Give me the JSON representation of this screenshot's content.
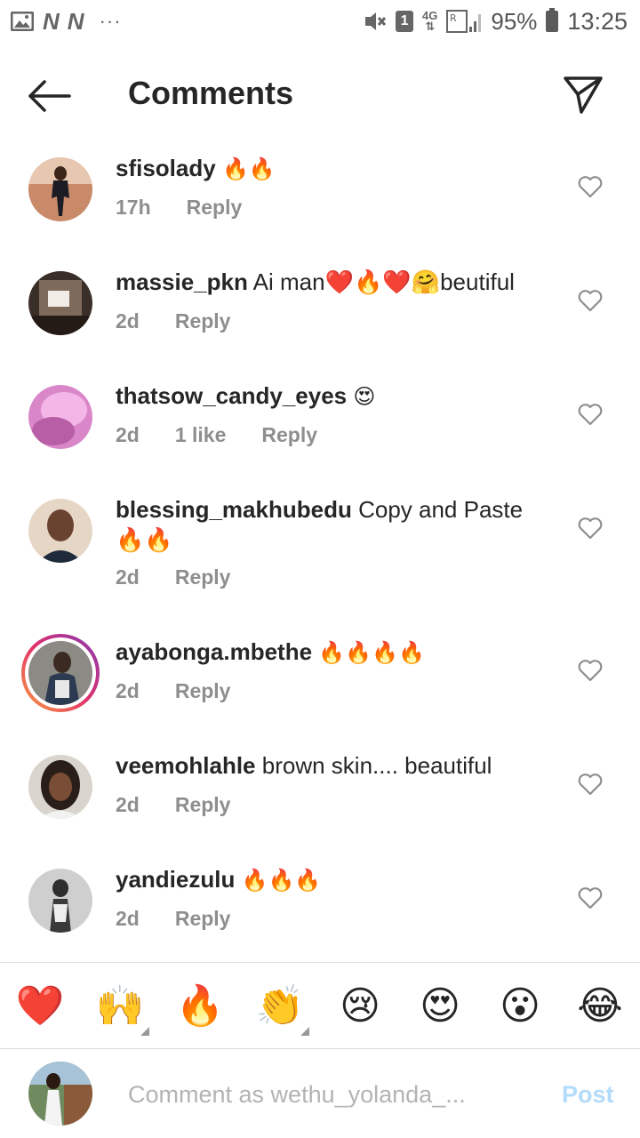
{
  "status_bar": {
    "left_letters": [
      "N",
      "N"
    ],
    "dots": "···",
    "sim_badge": "1",
    "network": "4G",
    "roaming": "R",
    "battery": "95%",
    "time": "13:25"
  },
  "header": {
    "title": "Comments",
    "back_icon": "arrow-left-icon",
    "send_icon": "paper-plane-icon"
  },
  "comments": [
    {
      "username": "sfisolady",
      "text": "🔥🔥",
      "time": "17h",
      "likes": "",
      "reply": "Reply"
    },
    {
      "username": "massie_pkn",
      "text": "Ai man❤️🔥❤️🤗beutiful",
      "time": "2d",
      "likes": "",
      "reply": "Reply"
    },
    {
      "username": "thatsow_candy_eyes",
      "text": "😍",
      "time": "2d",
      "likes": "1 like",
      "reply": "Reply"
    },
    {
      "username": "blessing_makhubedu",
      "text": "Copy and Paste 🔥🔥",
      "time": "2d",
      "likes": "",
      "reply": "Reply"
    },
    {
      "username": "ayabonga.mbethe",
      "text": "🔥🔥🔥🔥",
      "time": "2d",
      "likes": "",
      "reply": "Reply",
      "story_ring": true
    },
    {
      "username": "veemohlahle",
      "text": "brown skin.... beautiful",
      "time": "2d",
      "likes": "",
      "reply": "Reply"
    },
    {
      "username": "yandiezulu",
      "text": "🔥🔥🔥",
      "time": "2d",
      "likes": "",
      "reply": "Reply"
    }
  ],
  "quick_emojis": [
    "❤️",
    "🙌",
    "🔥",
    "👏",
    "😢",
    "😍",
    "😮",
    "😂"
  ],
  "composer": {
    "placeholder": "Comment as wethu_yolanda_...",
    "post_label": "Post"
  },
  "colors": {
    "text": "#262626",
    "meta": "#8e8e8e",
    "post_disabled": "#b3dbfb",
    "divider": "#dbdbdb"
  }
}
